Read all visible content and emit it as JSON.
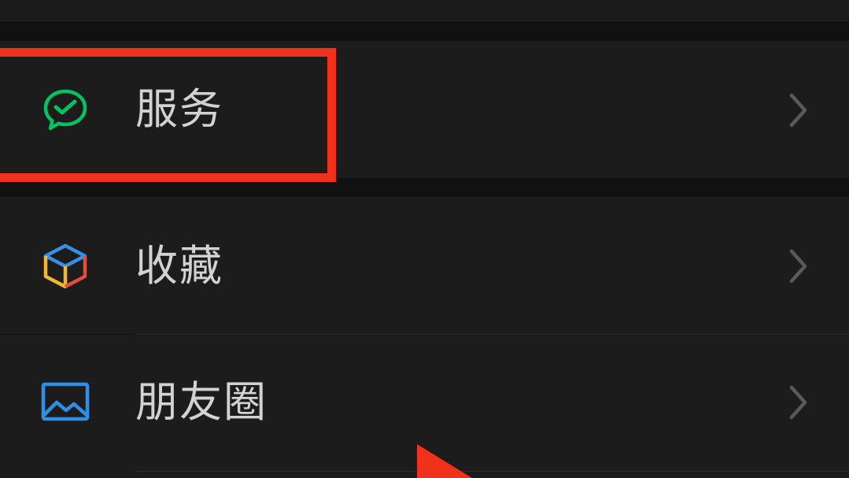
{
  "menu": {
    "items": [
      {
        "label": "服务",
        "icon": "wechat-pay-icon",
        "icon_color": "#07c160"
      },
      {
        "label": "收藏",
        "icon": "favorites-cube-icon",
        "icon_colors": [
          "#3a8ee6",
          "#f2b632",
          "#e64b3c"
        ]
      },
      {
        "label": "朋友圈",
        "icon": "moments-photo-icon",
        "icon_color": "#2f8fe6"
      }
    ],
    "chevron_icon": "chevron-right-icon"
  },
  "annotation": {
    "highlight_color": "#f0321c",
    "pointer_icon": "red-arrow-pointer-icon"
  },
  "theme": {
    "background": "#111111",
    "row_background": "#1c1c1c",
    "text_color": "#d2d2d2",
    "chevron_color": "#5a5a5a"
  }
}
